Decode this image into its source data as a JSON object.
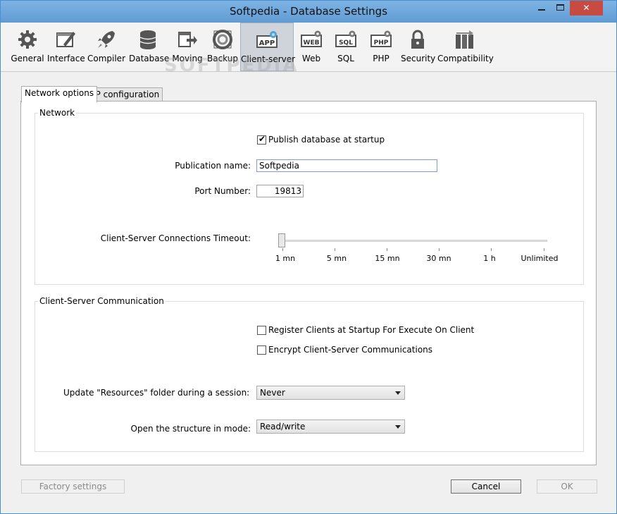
{
  "window": {
    "title": "Softpedia - Database Settings"
  },
  "watermark": "SOFTPEDIA",
  "toolbar": {
    "items": [
      {
        "label": "General",
        "icon": "gear-icon"
      },
      {
        "label": "Interface",
        "icon": "interface-icon"
      },
      {
        "label": "Compiler",
        "icon": "rocket-icon"
      },
      {
        "label": "Database",
        "icon": "database-icon"
      },
      {
        "label": "Moving",
        "icon": "moving-icon"
      },
      {
        "label": "Backup",
        "icon": "backup-icon"
      },
      {
        "label": "Client-server",
        "icon": "app-icon",
        "badge": "APP"
      },
      {
        "label": "Web",
        "icon": "web-icon",
        "badge": "WEB"
      },
      {
        "label": "SQL",
        "icon": "sql-icon",
        "badge": "SQL"
      },
      {
        "label": "PHP",
        "icon": "php-icon",
        "badge": "PHP"
      },
      {
        "label": "Security",
        "icon": "lock-icon"
      },
      {
        "label": "Compatibility",
        "icon": "compatibility-icon"
      }
    ]
  },
  "tabs": {
    "network": "Network options",
    "ip": "IP configuration"
  },
  "network": {
    "title": "Network",
    "publish_label": "Publish database at startup",
    "publish_checked": true,
    "pubname_label": "Publication name:",
    "pubname_value": "Softpedia",
    "port_label": "Port Number:",
    "port_value": "19813",
    "timeout_label": "Client-Server Connections Timeout:",
    "timeout_ticks": [
      "1 mn",
      "5 mn",
      "15 mn",
      "30 mn",
      "1 h",
      "Unlimited"
    ],
    "timeout_selected_index": 0
  },
  "comm": {
    "title": "Client-Server Communication",
    "register_label": "Register Clients at Startup For Execute On Client",
    "register_checked": false,
    "encrypt_label": "Encrypt Client-Server Communications",
    "encrypt_checked": false,
    "resources_label": "Update \"Resources\" folder during a session:",
    "resources_value": "Never",
    "structure_label": "Open the structure in mode:",
    "structure_value": "Read/write"
  },
  "buttons": {
    "factory": "Factory settings",
    "cancel": "Cancel",
    "ok": "OK"
  },
  "colors": {
    "titlebar": "#6fa8dc",
    "close": "#c74b40",
    "selected_tool": "#cfd4da"
  }
}
